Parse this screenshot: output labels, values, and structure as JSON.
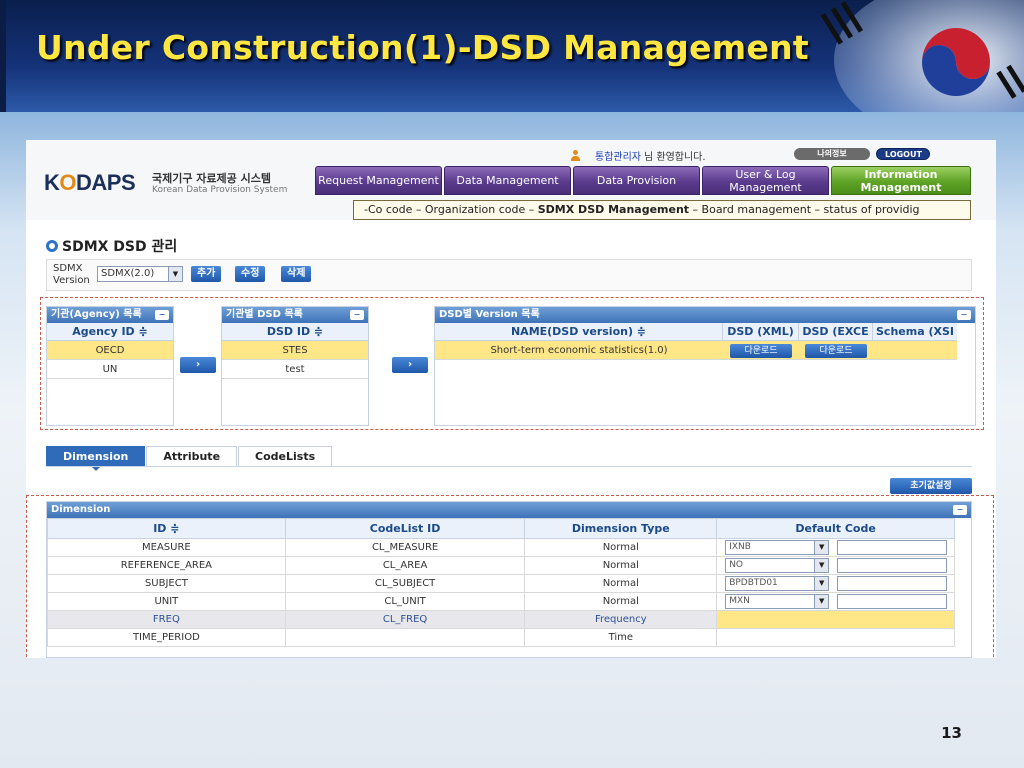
{
  "slide": {
    "title": "Under Construction(1)-DSD Management",
    "page_number": "13"
  },
  "header": {
    "logo_text_a": "K",
    "logo_text_b": "O",
    "logo_text_c": "DAPS",
    "logo_kor": "국제기구 자료제공 시스템",
    "logo_eng": "Korean Data Provision System",
    "user_name": "통합관리자",
    "welcome": "님 환영합니다.",
    "my_info": "나의정보",
    "logout": "LOGOUT"
  },
  "nav": {
    "items": [
      {
        "label": "Request Management"
      },
      {
        "label": "Data Management"
      },
      {
        "label": "Data Provision"
      },
      {
        "label": "User & Log Management"
      },
      {
        "label": "Information Management"
      }
    ]
  },
  "breadcrumb": {
    "part1": "-Co code – Organization code – ",
    "bold": "SDMX DSD Management",
    "part2": " – Board management – status of providig"
  },
  "page": {
    "heading": "SDMX DSD 관리",
    "version_label_1": "SDMX",
    "version_label_2": "Version",
    "version_value": "SDMX(2.0)",
    "btn_add": "추가",
    "btn_edit": "수정",
    "btn_delete": "삭제"
  },
  "agency_panel": {
    "title": "기관(Agency) 목록",
    "col": "Agency ID ≑",
    "rows": [
      "OECD",
      "UN"
    ]
  },
  "dsd_panel": {
    "title": "기관별 DSD 목록",
    "col": "DSD ID ≑",
    "rows": [
      "STES",
      "test"
    ]
  },
  "version_panel": {
    "title": "DSD별 Version 목록",
    "cols": [
      "NAME(DSD version) ≑",
      "DSD (XML)",
      "DSD (EXCE",
      "Schema (XSI"
    ],
    "row_name": "Short-term economic statistics(1.0)",
    "download": "다운로드"
  },
  "move_btn": "›",
  "collapse_icon": "−",
  "tabs": [
    "Dimension",
    "Attribute",
    "CodeLists"
  ],
  "reset_button": "초기값설정",
  "dimension_panel": {
    "title": "Dimension",
    "cols": [
      "ID ≑",
      "CodeList ID",
      "Dimension Type",
      "Default Code"
    ],
    "rows": [
      {
        "id": "MEASURE",
        "codelist": "CL_MEASURE",
        "type": "Normal",
        "code": "IXNB"
      },
      {
        "id": "REFERENCE_AREA",
        "codelist": "CL_AREA",
        "type": "Normal",
        "code": "NO"
      },
      {
        "id": "SUBJECT",
        "codelist": "CL_SUBJECT",
        "type": "Normal",
        "code": "BPDBTD01"
      },
      {
        "id": "UNIT",
        "codelist": "CL_UNIT",
        "type": "Normal",
        "code": "MXN"
      },
      {
        "id": "FREQ",
        "codelist": "CL_FREQ",
        "type": "Frequency",
        "code": ""
      },
      {
        "id": "TIME_PERIOD",
        "codelist": "",
        "type": "Time",
        "code": ""
      }
    ]
  },
  "colors": {
    "title": "#ffe640",
    "nav_purple": "#5a3b8d",
    "nav_green": "#5ea326",
    "selection": "#ffe687",
    "accent_blue": "#2f6bb8"
  }
}
